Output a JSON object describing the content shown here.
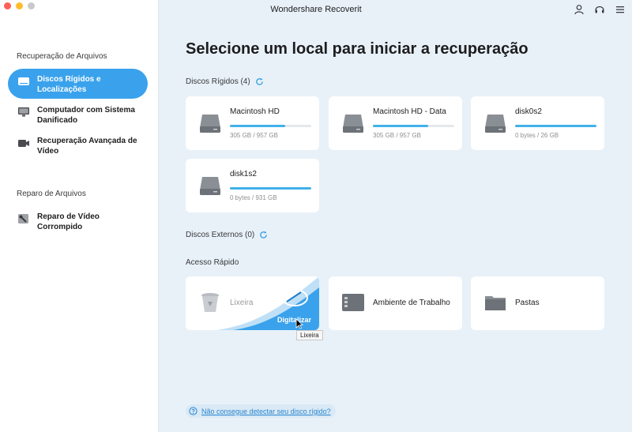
{
  "window": {
    "title": "Wondershare Recoverit"
  },
  "sidebar": {
    "sections": [
      {
        "label": "Recuperação de Arquivos"
      },
      {
        "label": "Reparo de Arquivos"
      }
    ],
    "items": [
      {
        "label": "Discos Rígidos e Localizações",
        "icon": "hard-drive-icon",
        "active": true
      },
      {
        "label": "Computador com Sistema Danificado",
        "icon": "monitor-icon",
        "active": false
      },
      {
        "label": "Recuperação Avançada de Vídeo",
        "icon": "video-camera-icon",
        "active": false
      },
      {
        "label": "Reparo de Vídeo Corrompido",
        "icon": "video-repair-icon",
        "active": false
      }
    ]
  },
  "header": {
    "icons": [
      "user-icon",
      "headset-icon",
      "menu-icon"
    ]
  },
  "main": {
    "title": "Selecione um local para iniciar a recuperação",
    "hard_drives": {
      "label": "Discos Rígidos (4)",
      "drives": [
        {
          "name": "Macintosh HD",
          "size": "305 GB / 957 GB",
          "used_fraction": 0.68
        },
        {
          "name": "Macintosh HD - Data",
          "size": "305 GB / 957 GB",
          "used_fraction": 0.68
        },
        {
          "name": "disk0s2",
          "size": "0 bytes / 26 GB",
          "used_fraction": 1.0
        },
        {
          "name": "disk1s2",
          "size": "0 bytes / 931 GB",
          "used_fraction": 1.0
        }
      ]
    },
    "external_drives": {
      "label": "Discos Externos (0)"
    },
    "quick_access": {
      "label": "Acesso Rápido",
      "items": [
        {
          "name": "Lixeira",
          "icon": "trash-icon",
          "scan_label": "Digitalizar"
        },
        {
          "name": "Ambiente de Trabalho",
          "icon": "desktop-icon"
        },
        {
          "name": "Pastas",
          "icon": "folder-icon"
        }
      ],
      "tooltip": "Lixeira"
    },
    "help_link": "Não consegue detectar seu disco rígido?"
  },
  "colors": {
    "accent": "#3aa2ec",
    "bar": "#40b1ea",
    "background": "#e8f1f8"
  }
}
